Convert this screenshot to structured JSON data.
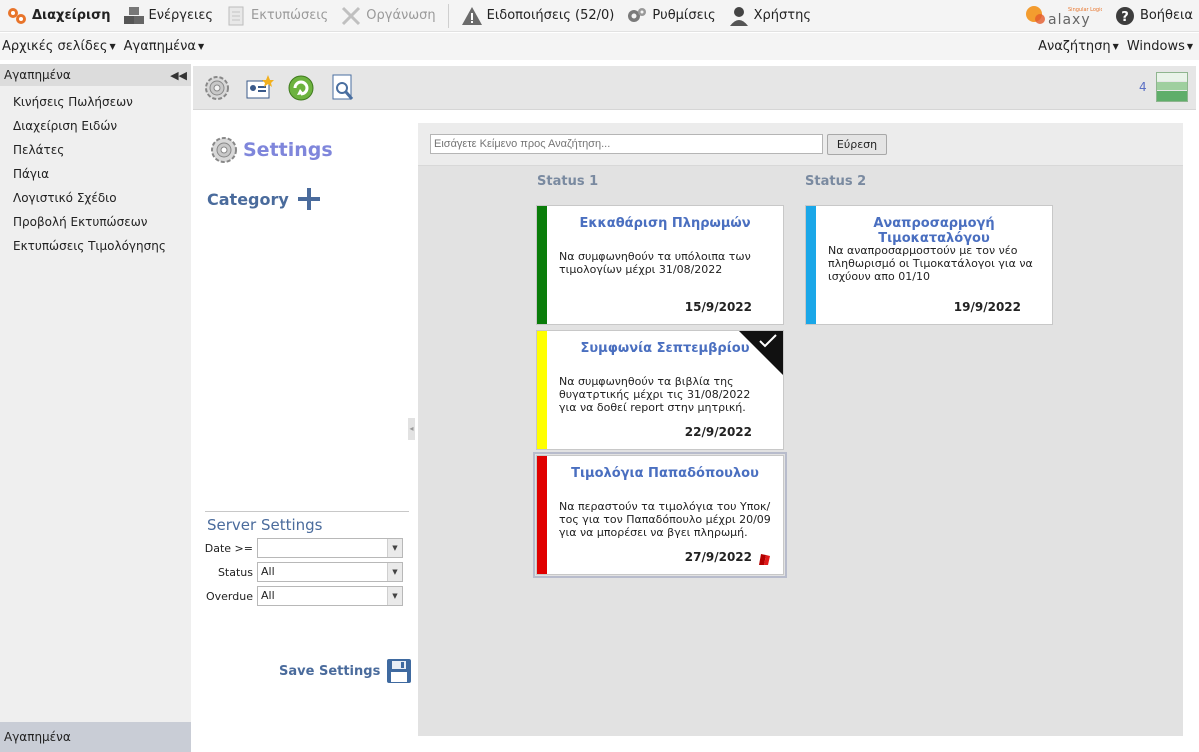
{
  "topbar": {
    "items": [
      {
        "label": "Διαχείριση",
        "icon": "gears-icon",
        "state": "active"
      },
      {
        "label": "Ενέργειες",
        "icon": "boxes-icon",
        "state": "enabled"
      },
      {
        "label": "Εκτυπώσεις",
        "icon": "document-icon",
        "state": "disabled"
      },
      {
        "label": "Οργάνωση",
        "icon": "tools-icon",
        "state": "disabled"
      },
      {
        "label": "Ειδοποιήσεις (52/0)",
        "icon": "warning-icon",
        "state": "enabled"
      },
      {
        "label": "Ρυθμίσεις",
        "icon": "settings-icon",
        "state": "enabled"
      },
      {
        "label": "Χρήστης",
        "icon": "user-icon",
        "state": "enabled"
      }
    ],
    "logo_text": "Galaxy",
    "logo_tagline": "Singular Logic",
    "help_label": "Βοήθεια"
  },
  "menubar": {
    "left": [
      "Αρχικές σελίδες",
      "Αγαπημένα"
    ],
    "right": [
      "Αναζήτηση",
      "Windows"
    ]
  },
  "sidebar": {
    "header": "Αγαπημένα",
    "items": [
      "Κινήσεις Πωλήσεων",
      "Διαχείριση Ειδών",
      "Πελάτες",
      "Πάγια",
      "Λογιστικό Σχέδιο",
      "Προβολή Εκτυπώσεων",
      "Εκτυπώσεις Τιμολόγησης"
    ],
    "footer": "Αγαπημένα"
  },
  "toolbar": {
    "count": "4",
    "buttons": [
      "settings-icon",
      "contact-card-icon",
      "refresh-icon",
      "preview-icon"
    ]
  },
  "settings": {
    "title": "Settings",
    "category_label": "Category",
    "server_title": "Server Settings",
    "fields": [
      {
        "label": "Date >=",
        "value": ""
      },
      {
        "label": "Status",
        "value": "All"
      },
      {
        "label": "Overdue",
        "value": "All"
      }
    ],
    "save_label": "Save Settings"
  },
  "board": {
    "search_placeholder": "Εισάγετε Κείμενο προς Αναζήτηση...",
    "search_button": "Εύρεση",
    "columns": [
      {
        "title": "Status 1",
        "cards": [
          {
            "title": "Εκκαθάριση Πληρωμών",
            "description": "Να συμφωνηθούν τα υπόλοιπα των τιμολογίων μέχρι  31/08/2022",
            "date": "15/9/2022",
            "color": "#0a7d0a",
            "done": false,
            "flag": false,
            "selected": false
          },
          {
            "title": "Συμφωνία Σεπτεμβρίου",
            "description": "Να συμφωνηθούν τα βιβλία της θυγατρτικής μέχρι τις 31/08/2022 για να δοθεί report στην μητρική.",
            "date": "22/9/2022",
            "color": "#ffff00",
            "done": true,
            "flag": false,
            "selected": false
          },
          {
            "title": "Τιμολόγια Παπαδόπουλου",
            "description": "Να περαστούν  τα τιμολόγια του Υποκ/τος για τον Παπαδόπουλο μέχρι 20/09 για να μπορέσει να βγει πληρωμή.",
            "date": "27/9/2022",
            "color": "#e00000",
            "done": false,
            "flag": true,
            "selected": true
          }
        ]
      },
      {
        "title": "Status 2",
        "cards": [
          {
            "title": "Αναπροσαρμογή Τιμοκαταλόγου",
            "description": "Να αναπροσαρμοστούν με τον νέο πληθωρισμό οι Τιμοκατάλογοι για να ισχύουν απο 01/10",
            "date": "19/9/2022",
            "color": "#1aa7e8",
            "done": false,
            "flag": false,
            "selected": false
          }
        ]
      }
    ]
  }
}
